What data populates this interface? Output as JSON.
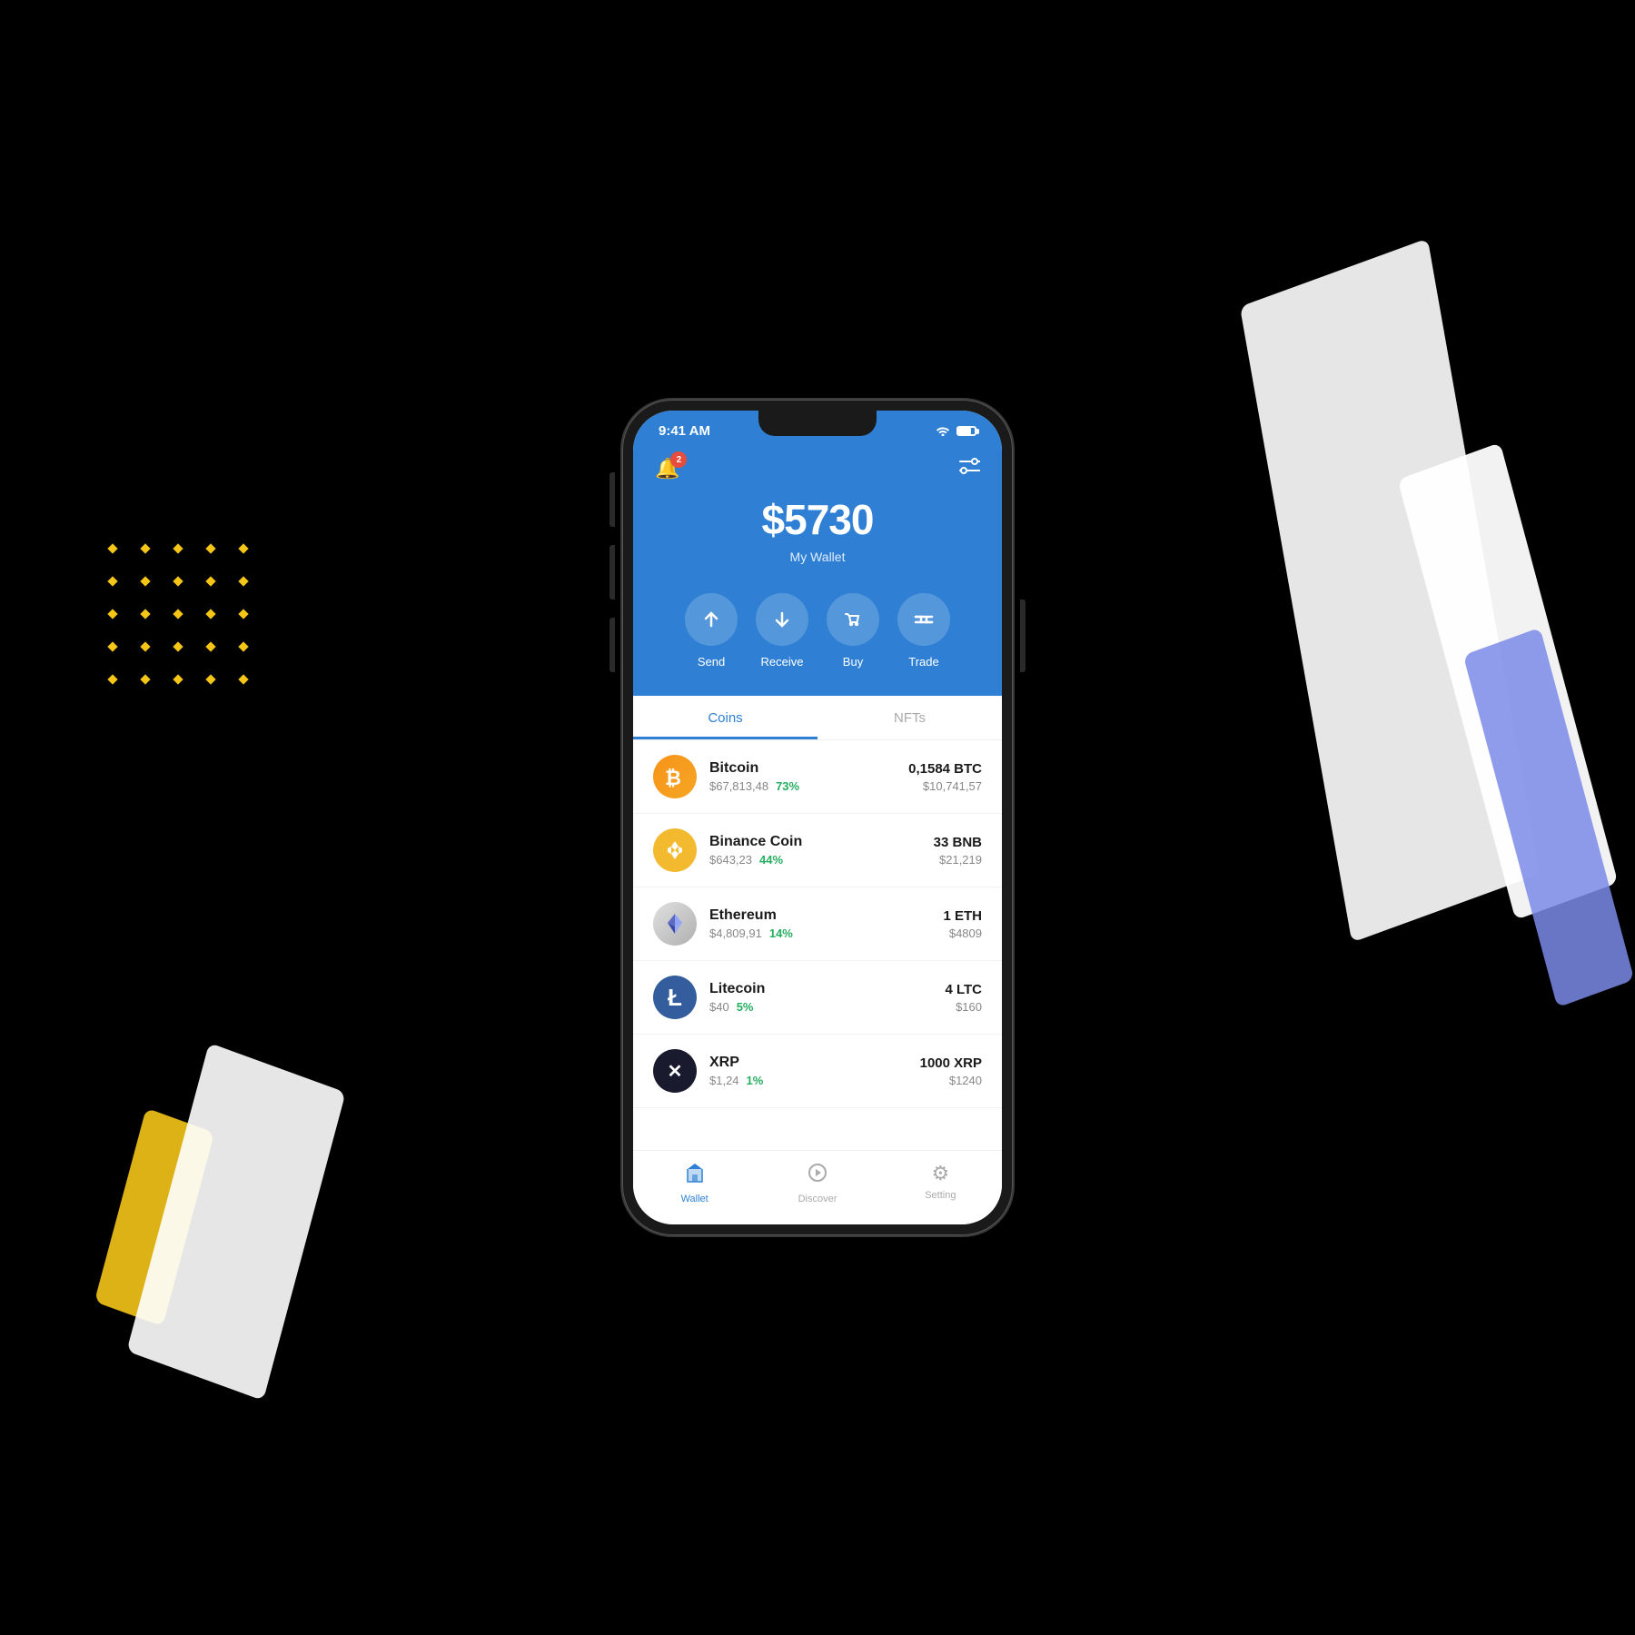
{
  "background": "#000",
  "decorations": {
    "dotGrid": {
      "color": "#f5c518"
    }
  },
  "phone": {
    "statusBar": {
      "time": "9:41 AM",
      "wifi": "wifi",
      "battery": "battery"
    },
    "header": {
      "notificationBadge": "2",
      "totalAmount": "$5730",
      "walletLabel": "My Wallet",
      "actions": [
        {
          "icon": "↑",
          "label": "Send"
        },
        {
          "icon": "↓",
          "label": "Receive"
        },
        {
          "icon": "🏷",
          "label": "Buy"
        },
        {
          "icon": "⇄",
          "label": "Trade"
        }
      ]
    },
    "tabs": [
      {
        "label": "Coins",
        "active": true
      },
      {
        "label": "NFTs",
        "active": false
      }
    ],
    "coins": [
      {
        "name": "Bitcoin",
        "price": "$67,813,48",
        "change": "73%",
        "amount": "0,1584 BTC",
        "value": "$10,741,57",
        "color": "#f7931a",
        "symbol": "₿",
        "logoType": "btc"
      },
      {
        "name": "Binance Coin",
        "price": "$643,23",
        "change": "44%",
        "amount": "33 BNB",
        "value": "$21,219",
        "color": "#f3ba2f",
        "symbol": "◆",
        "logoType": "bnb"
      },
      {
        "name": "Ethereum",
        "price": "$4,809,91",
        "change": "14%",
        "amount": "1 ETH",
        "value": "$4809",
        "color": "#c0c0c0",
        "symbol": "⟠",
        "logoType": "eth"
      },
      {
        "name": "Litecoin",
        "price": "$40",
        "change": "5%",
        "amount": "4 LTC",
        "value": "$160",
        "color": "#345d9d",
        "symbol": "Ł",
        "logoType": "ltc"
      },
      {
        "name": "XRP",
        "price": "$1,24",
        "change": "1%",
        "amount": "1000 XRP",
        "value": "$1240",
        "color": "#1a1a2e",
        "symbol": "✕",
        "logoType": "xrp"
      }
    ],
    "bottomNav": [
      {
        "label": "Wallet",
        "icon": "🛡",
        "active": true
      },
      {
        "label": "Discover",
        "icon": "🧭",
        "active": false
      },
      {
        "label": "Setting",
        "icon": "⚙",
        "active": false
      }
    ]
  }
}
